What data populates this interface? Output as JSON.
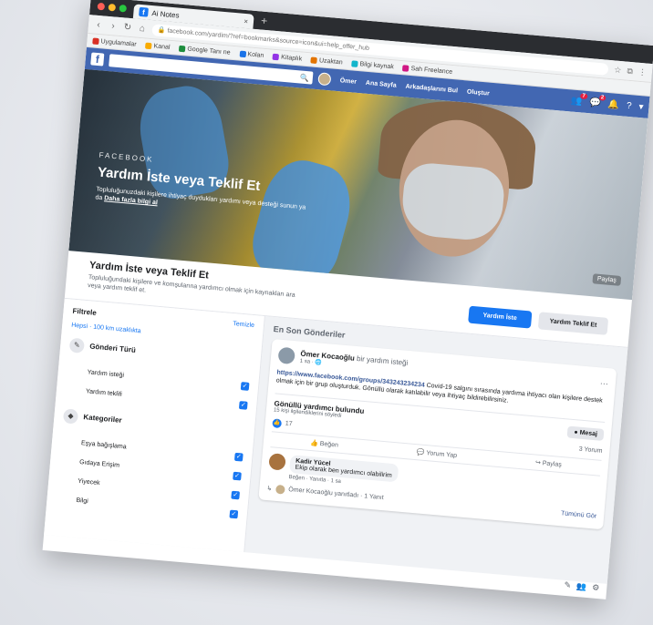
{
  "browser": {
    "tab_title": "Ai Notes",
    "url": "facebook.com/yardim/?ref=bookmarks&source=icon&ui=help_offer_hub",
    "bookmarks": [
      "Uygulamalar",
      "Kanal",
      "Google Tanı ne",
      "Kolan",
      "Kitaplık",
      "Uzaktan",
      "Bilgi kaynak",
      "Sah Freelance"
    ],
    "bookmark_colors": [
      "#d93025",
      "#f9ab00",
      "#1e8e3e",
      "#1a73e8",
      "#9334e6",
      "#e37400",
      "#12b5cb",
      "#d01884"
    ]
  },
  "fb": {
    "logo": "f",
    "search_icon": "🔍",
    "nav": [
      "Ömer",
      "Ana Sayfa",
      "Arkadaşlarını Bul",
      "Oluştur"
    ],
    "notif_count_1": "7",
    "notif_count_2": "2"
  },
  "cover": {
    "brand": "FACEBOOK",
    "title": "Yardım İste veya Teklif Et",
    "desc": "Topluluğunuzdaki kişilere ihtiyaç duydukları yardımı veya desteği sunun ya da",
    "desc_link": "Daha fazla bilgi al",
    "share": "Paylaş"
  },
  "page": {
    "title": "Yardım İste veya Teklif Et",
    "desc": "Topluluğundaki kişilere ve komşularına yardımcı olmak için kaynakları ara veya yardım teklif et.",
    "btn_primary": "Yardım İste",
    "btn_secondary": "Yardım Teklif Et"
  },
  "sidebar": {
    "title": "Filtrele",
    "clear": "Temizle",
    "location": "Hepsi · 100 km uzaklıkta",
    "sections": [
      {
        "label": "Gönderi Türü",
        "options": [
          "Yardım isteği",
          "Yardım teklifi"
        ]
      },
      {
        "label": "Kategoriler",
        "options": [
          "Eşya bağışlama",
          "Gıdaya Erişim",
          "Yiyecek",
          "Bilgi"
        ]
      }
    ]
  },
  "feed": {
    "title": "En Son Gönderiler",
    "post": {
      "author": "Ömer Kocaoğlu",
      "author_suffix": "bir yardım isteği",
      "time": "1 sa · 🌐",
      "link": "https://www.facebook.com/groups/343243234234",
      "text": "Covid-19 salgını sırasında yardıma ihtiyacı olan kişilere destek olmak için bir grup oluşturduk. Gönüllü olarak katılabilir veya ihtiyaç bildirebilirsiniz.",
      "status_title": "Gönüllü yardımcı bulundu",
      "status_sub": "15 kişi ilgilendiklerini söyledi",
      "msg_btn": "Mesaj",
      "reaction_count": "17",
      "comment_count": "3 Yorum",
      "actions": [
        "Beğen",
        "Yorum Yap",
        "Paylaş"
      ],
      "comment_author": "Kadir Yücel",
      "comment_text": "Ekip olarak ben yardımcı olabilirim",
      "comment_meta": "Beğen · Yanıtla · 1 sa",
      "footer_text": "Ömer Kocaoğlu yanıtladı · 1 Yanıt",
      "footer_link": "Tümünü Gör"
    }
  }
}
